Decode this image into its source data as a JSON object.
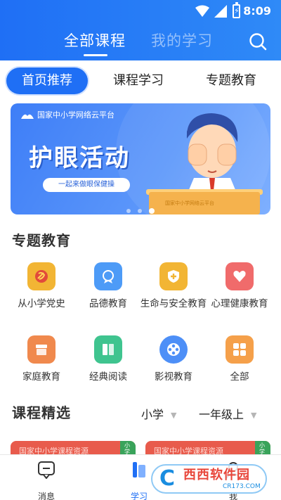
{
  "status_bar": {
    "time": "8:09",
    "battery_glyph": "⚡"
  },
  "header": {
    "tabs": [
      {
        "label": "全部课程",
        "active": true
      },
      {
        "label": "我的学习",
        "active": false
      }
    ],
    "search_icon": "search-icon"
  },
  "pills": [
    {
      "label": "首页推荐",
      "active": true
    },
    {
      "label": "课程学习",
      "active": false
    },
    {
      "label": "专题教育",
      "active": false
    }
  ],
  "banner": {
    "logo_text": "国家中小学网络云平台",
    "title": "护眼活动",
    "subtitle": "一起来做眼保健操",
    "podium_text": "国家中小学网络云平台",
    "dot_count": 3,
    "active_dot": 2
  },
  "topic_section": {
    "title": "专题教育",
    "items": [
      {
        "label": "从小学党史",
        "icon": "party-emblem-icon",
        "color": "#f2b534"
      },
      {
        "label": "品德教育",
        "icon": "medal-icon",
        "color": "#4d9bf7"
      },
      {
        "label": "生命与安全教育",
        "icon": "shield-icon",
        "color": "#f2b534"
      },
      {
        "label": "心理健康教育",
        "icon": "heart-icon",
        "color": "#f06b6b"
      },
      {
        "label": "家庭教育",
        "icon": "house-icon",
        "color": "#f0894d"
      },
      {
        "label": "经典阅读",
        "icon": "book-icon",
        "color": "#3fc48f"
      },
      {
        "label": "影视教育",
        "icon": "film-reel-icon",
        "color": "#4d8ff7"
      },
      {
        "label": "全部",
        "icon": "grid-icon",
        "color": "#f5a04a"
      }
    ]
  },
  "course_section": {
    "title": "课程精选",
    "filters": [
      {
        "label": "小学",
        "caret": "▼"
      },
      {
        "label": "一年级上",
        "caret": "▼"
      }
    ],
    "cards": [
      {
        "text": "国家中小学课程资源",
        "side": "小学"
      },
      {
        "text": "国家中小学课程资源",
        "side": "小学"
      }
    ]
  },
  "tabbar": {
    "items": [
      {
        "label": "消息",
        "icon": "message-icon",
        "active": false
      },
      {
        "label": "学习",
        "icon": "study-icon",
        "active": true
      },
      {
        "label": "我",
        "icon": "profile-icon",
        "active": false
      }
    ]
  },
  "watermark": {
    "glyph": "C",
    "title": "西西软件园",
    "url": "CR173.COM"
  },
  "colors": {
    "primary": "#1f6ff5",
    "banner": "#4a88f8",
    "card_red": "#e85b4c",
    "card_green": "#39a35a"
  }
}
